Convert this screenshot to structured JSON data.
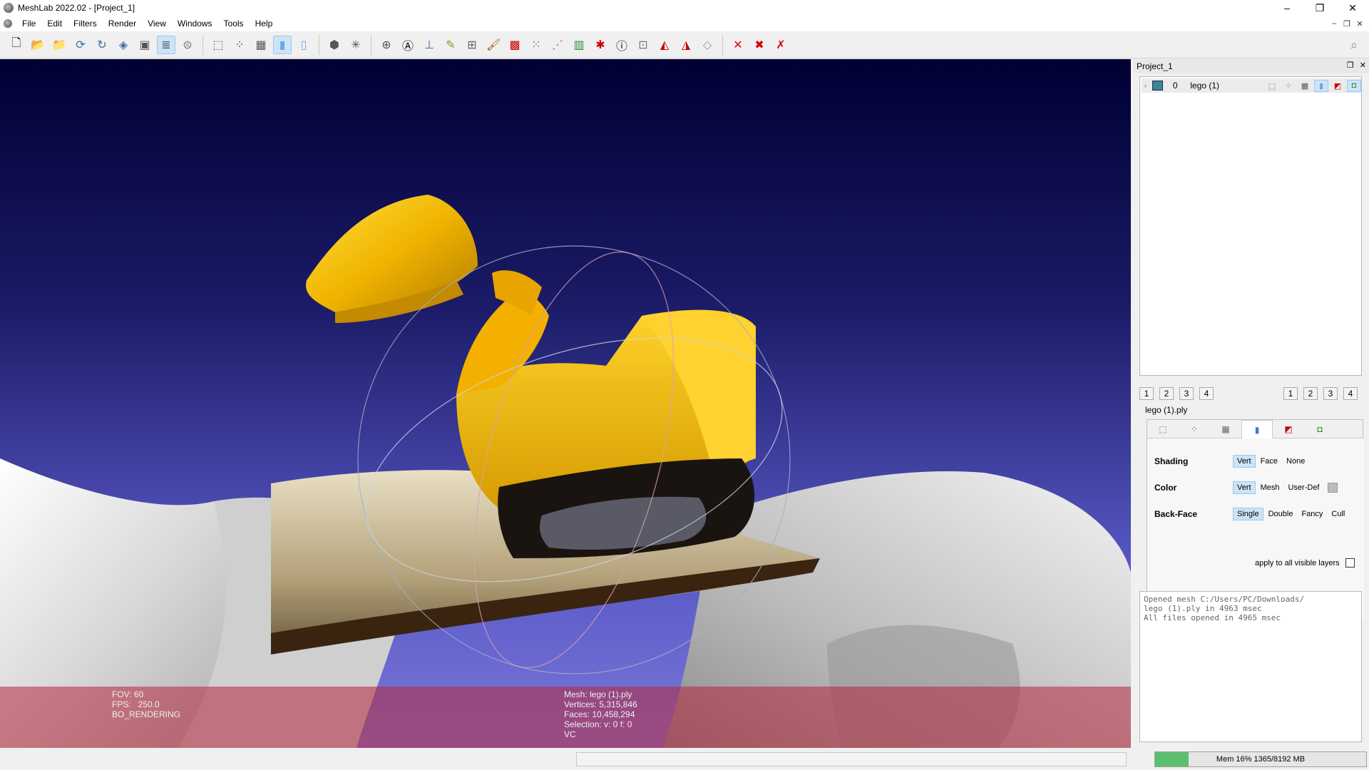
{
  "window": {
    "title": "MeshLab 2022.02 - [Project_1]",
    "minimize": "–",
    "restore": "❐",
    "close": "✕"
  },
  "menu": {
    "items": [
      "File",
      "Edit",
      "Filters",
      "Render",
      "View",
      "Windows",
      "Tools",
      "Help"
    ],
    "mdi_min": "–",
    "mdi_restore": "❐",
    "mdi_close": "✕"
  },
  "toolbar": {
    "icons": [
      "new-project-icon",
      "open-project-icon",
      "open-mesh-icon",
      "reload-icon",
      "reload-all-icon",
      "save-icon",
      "snapshot-icon",
      "layers-icon",
      "raster-layers-icon",
      "bbox-icon",
      "points-icon",
      "wireframe-icon",
      "flat-shading-icon",
      "smooth-icon",
      "decimate-icon",
      "axis-icon",
      "trackball-icon",
      "annotation-icon",
      "measure-icon",
      "pickpoints-icon",
      "align-icon",
      "paint-icon",
      "painting-icon",
      "select-vertices-icon",
      "select-faces-icon",
      "color-icon",
      "fix-icon",
      "info-icon",
      "edit-icon",
      "select-icon",
      "select-connected-icon",
      "select-region-icon",
      "delete-vertices-icon",
      "delete-faces-icon",
      "delete-all-icon"
    ]
  },
  "viewport": {
    "bg_top": "#000033",
    "bg_bottom": "#7a78d8",
    "overlay_left": {
      "fov": "FOV: 60",
      "fps": "FPS:   250.0",
      "mode": "BO_RENDERING"
    },
    "overlay_center": {
      "mesh": "Mesh: lego (1).ply",
      "vertices": "Vertices: 5,315,846",
      "faces": "Faces: 10,458,294",
      "selection": "Selection: v: 0 f: 0",
      "vc": "VC"
    }
  },
  "dock": {
    "title": "Project_1",
    "float_btn": "❐",
    "close_btn": "✕",
    "layers": [
      {
        "index": "0",
        "name": "lego (1)"
      }
    ],
    "left_nums": [
      "1",
      "2",
      "3",
      "4"
    ],
    "right_nums": [
      "1",
      "2",
      "3",
      "4"
    ],
    "file_label": "lego (1).ply",
    "shading": {
      "label": "Shading",
      "options": [
        "Vert",
        "Face",
        "None"
      ],
      "selected": "Vert"
    },
    "color": {
      "label": "Color",
      "options": [
        "Vert",
        "Mesh",
        "User-Def"
      ],
      "selected": "Vert"
    },
    "backface": {
      "label": "Back-Face",
      "options": [
        "Single",
        "Double",
        "Fancy",
        "Cull"
      ],
      "selected": "Single"
    },
    "apply_label": "apply to all visible layers",
    "log": [
      "Opened mesh C:/Users/PC/Downloads/",
      "lego (1).ply in 4963 msec",
      "All files opened in 4965 msec"
    ]
  },
  "status": {
    "mem_text": "Mem 16% 1365/8192 MB",
    "mem_fraction": 0.16
  }
}
